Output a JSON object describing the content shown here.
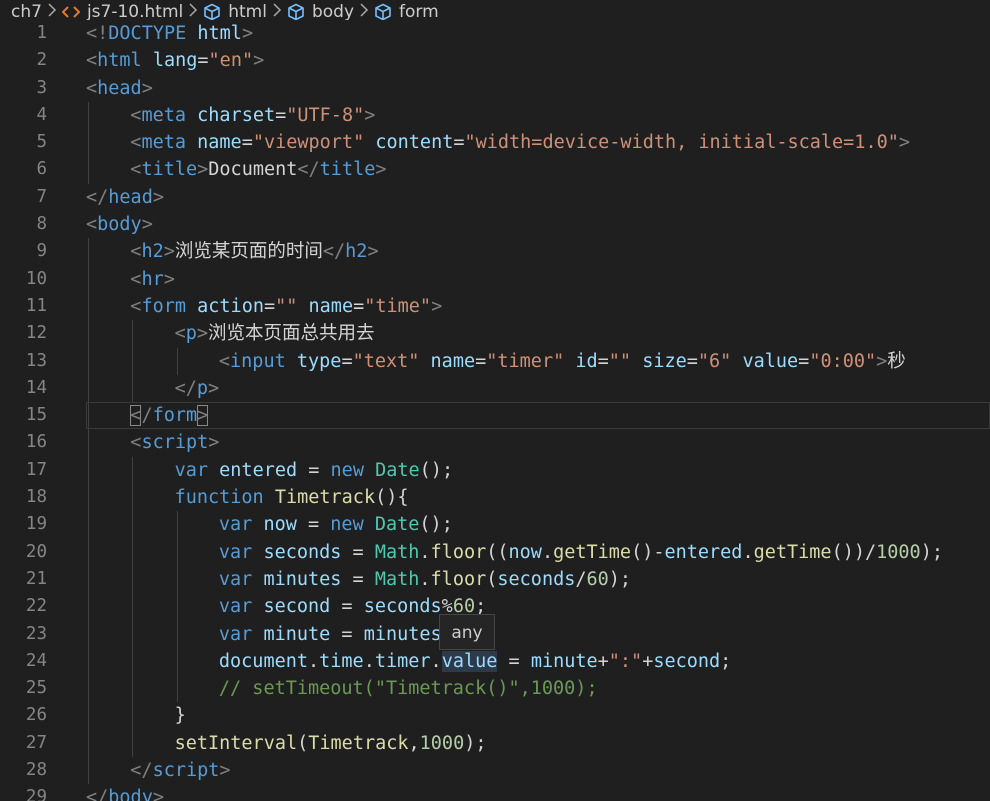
{
  "breadcrumb": {
    "folder": "ch7",
    "file": "js7-10.html",
    "path": [
      "html",
      "body",
      "form"
    ]
  },
  "icons": {
    "file": "html-file-icon",
    "element": "symbol-element-icon",
    "separator": "chevron-right-icon"
  },
  "colors": {
    "background": "#1f1f1f",
    "tag": "#569cd6",
    "attribute": "#9cdcfe",
    "string": "#ce9178",
    "function": "#dcdcaa",
    "class": "#4ec9b0",
    "number": "#b5cea8",
    "comment": "#6a9955",
    "file_icon": "#e37933",
    "element_icon": "#75beff"
  },
  "editor": {
    "current_line": 15,
    "hover_text": "any",
    "lines": [
      {
        "n": "1",
        "indent": 0,
        "tokens": [
          [
            "t-br",
            "<!"
          ],
          [
            "t-tag",
            "DOCTYPE"
          ],
          [
            "t-text",
            " "
          ],
          [
            "t-attr",
            "html"
          ],
          [
            "t-br",
            ">"
          ]
        ]
      },
      {
        "n": "2",
        "indent": 0,
        "tokens": [
          [
            "t-br",
            "<"
          ],
          [
            "t-tag",
            "html"
          ],
          [
            "t-text",
            " "
          ],
          [
            "t-attr",
            "lang"
          ],
          [
            "t-text",
            "="
          ],
          [
            "t-str",
            "\"en\""
          ],
          [
            "t-br",
            ">"
          ]
        ]
      },
      {
        "n": "3",
        "indent": 0,
        "tokens": [
          [
            "t-br",
            "<"
          ],
          [
            "t-tag",
            "head"
          ],
          [
            "t-br",
            ">"
          ]
        ]
      },
      {
        "n": "4",
        "indent": 1,
        "tokens": [
          [
            "t-br",
            "<"
          ],
          [
            "t-tag",
            "meta"
          ],
          [
            "t-text",
            " "
          ],
          [
            "t-attr",
            "charset"
          ],
          [
            "t-text",
            "="
          ],
          [
            "t-str",
            "\"UTF-8\""
          ],
          [
            "t-br",
            ">"
          ]
        ]
      },
      {
        "n": "5",
        "indent": 1,
        "tokens": [
          [
            "t-br",
            "<"
          ],
          [
            "t-tag",
            "meta"
          ],
          [
            "t-text",
            " "
          ],
          [
            "t-attr",
            "name"
          ],
          [
            "t-text",
            "="
          ],
          [
            "t-str",
            "\"viewport\""
          ],
          [
            "t-text",
            " "
          ],
          [
            "t-attr",
            "content"
          ],
          [
            "t-text",
            "="
          ],
          [
            "t-str",
            "\"width=device-width, initial-scale=1.0\""
          ],
          [
            "t-br",
            ">"
          ]
        ]
      },
      {
        "n": "6",
        "indent": 1,
        "tokens": [
          [
            "t-br",
            "<"
          ],
          [
            "t-tag",
            "title"
          ],
          [
            "t-br",
            ">"
          ],
          [
            "t-text",
            "Document"
          ],
          [
            "t-br",
            "</"
          ],
          [
            "t-tag",
            "title"
          ],
          [
            "t-br",
            ">"
          ]
        ]
      },
      {
        "n": "7",
        "indent": 0,
        "tokens": [
          [
            "t-br",
            "</"
          ],
          [
            "t-tag",
            "head"
          ],
          [
            "t-br",
            ">"
          ]
        ]
      },
      {
        "n": "8",
        "indent": 0,
        "tokens": [
          [
            "t-br",
            "<"
          ],
          [
            "t-tag",
            "body"
          ],
          [
            "t-br",
            ">"
          ]
        ]
      },
      {
        "n": "9",
        "indent": 1,
        "tokens": [
          [
            "t-br",
            "<"
          ],
          [
            "t-tag",
            "h2"
          ],
          [
            "t-br",
            ">"
          ],
          [
            "t-text",
            "浏览某页面的时间"
          ],
          [
            "t-br",
            "</"
          ],
          [
            "t-tag",
            "h2"
          ],
          [
            "t-br",
            ">"
          ]
        ]
      },
      {
        "n": "10",
        "indent": 1,
        "tokens": [
          [
            "t-br",
            "<"
          ],
          [
            "t-tag",
            "hr"
          ],
          [
            "t-br",
            ">"
          ]
        ]
      },
      {
        "n": "11",
        "indent": 1,
        "tokens": [
          [
            "t-br",
            "<"
          ],
          [
            "t-tag",
            "form"
          ],
          [
            "t-text",
            " "
          ],
          [
            "t-attr",
            "action"
          ],
          [
            "t-text",
            "="
          ],
          [
            "t-str",
            "\"\""
          ],
          [
            "t-text",
            " "
          ],
          [
            "t-attr",
            "name"
          ],
          [
            "t-text",
            "="
          ],
          [
            "t-str",
            "\"time\""
          ],
          [
            "t-br",
            ">"
          ]
        ]
      },
      {
        "n": "12",
        "indent": 2,
        "tokens": [
          [
            "t-br",
            "<"
          ],
          [
            "t-tag",
            "p"
          ],
          [
            "t-br",
            ">"
          ],
          [
            "t-text",
            "浏览本页面总共用去"
          ]
        ]
      },
      {
        "n": "13",
        "indent": 3,
        "tokens": [
          [
            "t-br",
            "<"
          ],
          [
            "t-tag",
            "input"
          ],
          [
            "t-text",
            " "
          ],
          [
            "t-attr",
            "type"
          ],
          [
            "t-text",
            "="
          ],
          [
            "t-str",
            "\"text\""
          ],
          [
            "t-text",
            " "
          ],
          [
            "t-attr",
            "name"
          ],
          [
            "t-text",
            "="
          ],
          [
            "t-str",
            "\"timer\""
          ],
          [
            "t-text",
            " "
          ],
          [
            "t-attr",
            "id"
          ],
          [
            "t-text",
            "="
          ],
          [
            "t-str",
            "\"\""
          ],
          [
            "t-text",
            " "
          ],
          [
            "t-attr",
            "size"
          ],
          [
            "t-text",
            "="
          ],
          [
            "t-str",
            "\"6\""
          ],
          [
            "t-text",
            " "
          ],
          [
            "t-attr",
            "value"
          ],
          [
            "t-text",
            "="
          ],
          [
            "t-str",
            "\"0:00\""
          ],
          [
            "t-br",
            ">"
          ],
          [
            "t-text",
            "秒"
          ]
        ]
      },
      {
        "n": "14",
        "indent": 2,
        "tokens": [
          [
            "t-br",
            "</"
          ],
          [
            "t-tag",
            "p"
          ],
          [
            "t-br",
            ">"
          ]
        ]
      },
      {
        "n": "15",
        "indent": 1,
        "tokens": [
          [
            "t-br hl-bracket",
            "<"
          ],
          [
            "t-br",
            "/"
          ],
          [
            "t-tag",
            "form"
          ],
          [
            "t-br hl-bracket",
            ">"
          ]
        ]
      },
      {
        "n": "16",
        "indent": 1,
        "tokens": [
          [
            "t-br",
            "<"
          ],
          [
            "t-tag",
            "script"
          ],
          [
            "t-br",
            ">"
          ]
        ]
      },
      {
        "n": "17",
        "indent": 2,
        "tokens": [
          [
            "t-kw",
            "var"
          ],
          [
            "t-text",
            " "
          ],
          [
            "t-var",
            "entered"
          ],
          [
            "t-op",
            " = "
          ],
          [
            "t-kw",
            "new"
          ],
          [
            "t-text",
            " "
          ],
          [
            "t-cls",
            "Date"
          ],
          [
            "t-punc",
            "();"
          ]
        ]
      },
      {
        "n": "18",
        "indent": 2,
        "tokens": [
          [
            "t-kw",
            "function"
          ],
          [
            "t-text",
            " "
          ],
          [
            "t-fn",
            "Timetrack"
          ],
          [
            "t-punc",
            "(){"
          ]
        ]
      },
      {
        "n": "19",
        "indent": 3,
        "tokens": [
          [
            "t-kw",
            "var"
          ],
          [
            "t-text",
            " "
          ],
          [
            "t-var",
            "now"
          ],
          [
            "t-op",
            " = "
          ],
          [
            "t-kw",
            "new"
          ],
          [
            "t-text",
            " "
          ],
          [
            "t-cls",
            "Date"
          ],
          [
            "t-punc",
            "();"
          ]
        ]
      },
      {
        "n": "20",
        "indent": 3,
        "tokens": [
          [
            "t-kw",
            "var"
          ],
          [
            "t-text",
            " "
          ],
          [
            "t-var",
            "seconds"
          ],
          [
            "t-op",
            " = "
          ],
          [
            "t-cls",
            "Math"
          ],
          [
            "t-punc",
            "."
          ],
          [
            "t-fn",
            "floor"
          ],
          [
            "t-punc",
            "(("
          ],
          [
            "t-var",
            "now"
          ],
          [
            "t-punc",
            "."
          ],
          [
            "t-fn",
            "getTime"
          ],
          [
            "t-punc",
            "()"
          ],
          [
            "t-op",
            "-"
          ],
          [
            "t-var",
            "entered"
          ],
          [
            "t-punc",
            "."
          ],
          [
            "t-fn",
            "getTime"
          ],
          [
            "t-punc",
            "())"
          ],
          [
            "t-op",
            "/"
          ],
          [
            "t-num",
            "1000"
          ],
          [
            "t-punc",
            ");"
          ]
        ]
      },
      {
        "n": "21",
        "indent": 3,
        "tokens": [
          [
            "t-kw",
            "var"
          ],
          [
            "t-text",
            " "
          ],
          [
            "t-var",
            "minutes"
          ],
          [
            "t-op",
            " = "
          ],
          [
            "t-cls",
            "Math"
          ],
          [
            "t-punc",
            "."
          ],
          [
            "t-fn",
            "floor"
          ],
          [
            "t-punc",
            "("
          ],
          [
            "t-var",
            "seconds"
          ],
          [
            "t-op",
            "/"
          ],
          [
            "t-num",
            "60"
          ],
          [
            "t-punc",
            ");"
          ]
        ]
      },
      {
        "n": "22",
        "indent": 3,
        "tokens": [
          [
            "t-kw",
            "var"
          ],
          [
            "t-text",
            " "
          ],
          [
            "t-var",
            "second"
          ],
          [
            "t-op",
            " = "
          ],
          [
            "t-var",
            "seconds"
          ],
          [
            "t-op",
            "%"
          ],
          [
            "t-num",
            "60"
          ],
          [
            "t-punc",
            ";"
          ]
        ]
      },
      {
        "n": "23",
        "indent": 3,
        "tokens": [
          [
            "t-kw",
            "var"
          ],
          [
            "t-text",
            " "
          ],
          [
            "t-var",
            "minute"
          ],
          [
            "t-op",
            " = "
          ],
          [
            "t-var",
            "minutes"
          ]
        ]
      },
      {
        "n": "24",
        "indent": 3,
        "tokens": [
          [
            "t-var",
            "document"
          ],
          [
            "t-punc",
            "."
          ],
          [
            "t-var",
            "time"
          ],
          [
            "t-punc",
            "."
          ],
          [
            "t-var",
            "timer"
          ],
          [
            "t-punc",
            "."
          ],
          [
            "t-var sel-word",
            "value"
          ],
          [
            "t-op",
            " = "
          ],
          [
            "t-var",
            "minute"
          ],
          [
            "t-op",
            "+"
          ],
          [
            "t-str",
            "\":\""
          ],
          [
            "t-op",
            "+"
          ],
          [
            "t-var",
            "second"
          ],
          [
            "t-punc",
            ";"
          ]
        ]
      },
      {
        "n": "25",
        "indent": 3,
        "tokens": [
          [
            "t-cm",
            "// setTimeout(\"Timetrack()\",1000);"
          ]
        ]
      },
      {
        "n": "26",
        "indent": 2,
        "tokens": [
          [
            "t-punc",
            "}"
          ]
        ]
      },
      {
        "n": "27",
        "indent": 2,
        "tokens": [
          [
            "t-fn",
            "setInterval"
          ],
          [
            "t-punc",
            "("
          ],
          [
            "t-fn",
            "Timetrack"
          ],
          [
            "t-punc",
            ","
          ],
          [
            "t-num",
            "1000"
          ],
          [
            "t-punc",
            ");"
          ]
        ]
      },
      {
        "n": "28",
        "indent": 1,
        "tokens": [
          [
            "t-br",
            "</"
          ],
          [
            "t-tag",
            "script"
          ],
          [
            "t-br",
            ">"
          ]
        ]
      },
      {
        "n": "29",
        "indent": 0,
        "tokens": [
          [
            "t-br",
            "</"
          ],
          [
            "t-tag",
            "body"
          ],
          [
            "t-br",
            ">"
          ]
        ]
      }
    ]
  }
}
